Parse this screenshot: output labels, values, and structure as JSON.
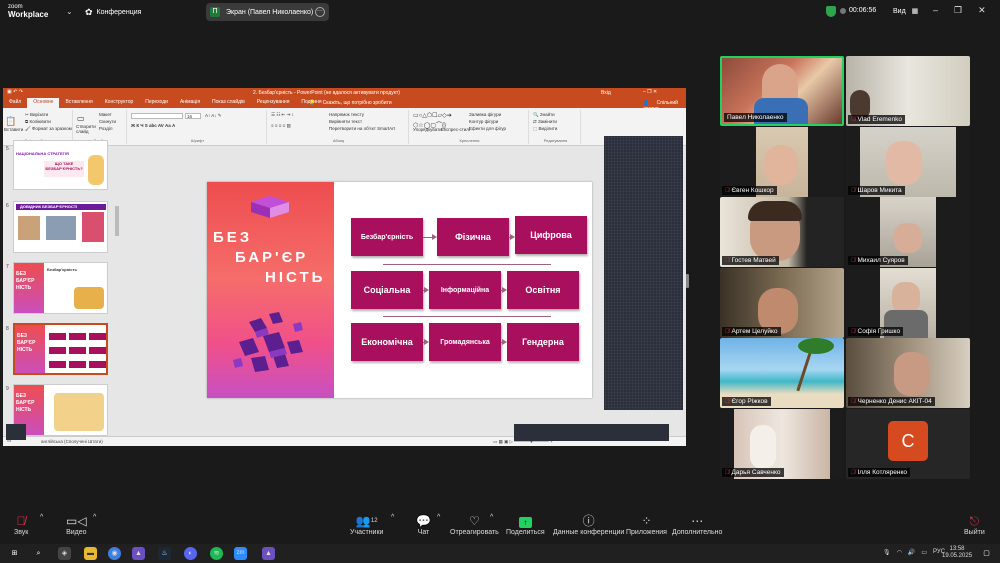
{
  "topbar": {
    "brand_top": "zoom",
    "brand_bottom": "Workplace",
    "conference_label": "Конференция",
    "screen_share_label": "Экран (Павел Николаенко)",
    "screen_initial": "П",
    "timer": "00:06:56",
    "view_label": "Вид"
  },
  "ppt": {
    "window_title": "2. Безбар'єрність - PowerPoint (не вдалося активувати продукт)",
    "signin_label": "Вхід",
    "tabs": [
      "Файл",
      "Основне",
      "Вставлення",
      "Конструктор",
      "Переходи",
      "Анімація",
      "Показ слайдів",
      "Рецензування",
      "Подання"
    ],
    "help_text": "Скажіть, що потрібно зробити",
    "share_label": "Спільний доступ",
    "ribbon": {
      "paste": "Вставити",
      "cut": "Вирізати",
      "copy": "Копіювати",
      "format_painter": "Формат за зразком",
      "clipboard": "Буфер обміну",
      "new_slide": "Створити слайд",
      "layout": "Макет",
      "reset": "Скинути",
      "section": "Розділ",
      "slides": "Слайди",
      "font": "Шрифт",
      "font_size": "16",
      "text_direction": "Напрямок тексту",
      "align_text": "Вирівняти текст",
      "smartart": "Перетворити на об'єкт SmartArt",
      "paragraph": "Абзац",
      "arrange": "Упорядкувати",
      "quick_styles": "Експрес-стилі",
      "shape_fill": "Заливка фігури",
      "shape_outline": "Контур фігури",
      "shape_effects": "Ефекти для фігур",
      "drawing": "Креслення",
      "find": "Знайти",
      "replace": "Замінити",
      "select": "Виділити",
      "editing": "Редагування"
    },
    "status_lang": "англійська (Сполучені Штати)",
    "thumb_numbers": [
      "5",
      "6",
      "7",
      "8",
      "9"
    ],
    "thumbs": {
      "t5_title": "НАЦІОНАЛЬНА СТРАТЕГІЯ",
      "t5_q": "ЩО ТАКЕ БЕЗБАР'ЄРНІСТЬ?",
      "t6_title": "ДОВІДНИК БЕЗБАР'ЄРНОСТІ",
      "t7_text": "Безбар'єрність",
      "t7_big": "БЕЗ БАР'ЄР НІСТЬ",
      "t8_big": "БЕЗ БАР'ЄР НІСТЬ",
      "t9_big": "БЕЗ БАР'ЄР НІСТЬ"
    }
  },
  "slide": {
    "title_line1": "БЕЗ",
    "title_line2": "БАР'ЄР",
    "title_line3": "НІСТЬ",
    "boxes": [
      "Безбар'єрність",
      "Фізична",
      "Цифрова",
      "Соціальна",
      "Інформаційна",
      "Освітня",
      "Економічна",
      "Громадянська",
      "Гендерна"
    ]
  },
  "participants": [
    {
      "name": "Павел Николаенко",
      "muted": false
    },
    {
      "name": "Vlad Eremenko",
      "muted": true
    },
    {
      "name": "Євген Кошкор",
      "muted": true
    },
    {
      "name": "Шаров Микита",
      "muted": true
    },
    {
      "name": "Гостев Матвей",
      "muted": true
    },
    {
      "name": "Михаил Суяров",
      "muted": true
    },
    {
      "name": "Артем Целуйко",
      "muted": true
    },
    {
      "name": "Софія Гришко",
      "muted": true
    },
    {
      "name": "Єгор Ріжков",
      "muted": true
    },
    {
      "name": "Черненко Денис АКІТ-04",
      "muted": true
    },
    {
      "name": "Дарья Савченко",
      "muted": true
    },
    {
      "name": "Ілля Котляренко",
      "muted": true
    }
  ],
  "avatar_letter": "C",
  "toolbar": {
    "audio": "Звук",
    "video": "Видео",
    "participants": "Участники",
    "participants_count": "12",
    "chat": "Чат",
    "react": "Отреагировать",
    "share": "Поделиться",
    "conf_data": "Данные конференции",
    "apps": "Приложения",
    "more": "Дополнительно",
    "leave": "Выйти"
  },
  "taskbar": {
    "lang": "РУС",
    "time": "13:58",
    "date": "19.05.2025",
    "zoom_badge": "zm"
  },
  "colors": {
    "slide_box": "#a8105e",
    "ppt_accent": "#c84b1f",
    "active_speaker": "#23d160"
  }
}
